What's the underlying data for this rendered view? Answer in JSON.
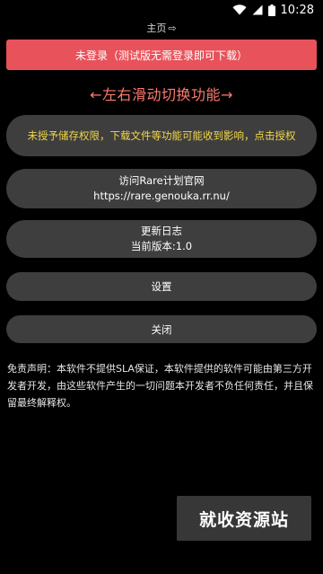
{
  "status_bar": {
    "time": "10:28"
  },
  "top_bar": {
    "title": "主页",
    "arrow": "⇨"
  },
  "login_banner": {
    "text": "未登录（测试版无需登录即可下载）"
  },
  "swipe_hint": {
    "text": "←左右滑动切换功能→"
  },
  "permission_notice": {
    "text": "未授予储存权限，下载文件等功能可能收到影响，点击授权"
  },
  "website": {
    "title": "访问Rare计划官网",
    "url": "https://rare.genouka.rr.nu/"
  },
  "changelog": {
    "title": "更新日志",
    "version": "当前版本:1.0"
  },
  "settings": {
    "label": "设置"
  },
  "close": {
    "label": "关闭"
  },
  "disclaimer": {
    "text": "免责声明：本软件不提供SLA保证，本软件提供的软件可能由第三方开发者开发，由这些软件产生的一切问题本开发者不负任何责任，并且保留最终解释权。"
  },
  "watermark": {
    "text": "就收资源站"
  },
  "colors": {
    "banner": "#e8525a",
    "hint": "#ff7b6e",
    "notice": "#f2d64a",
    "card": "#3e3e3e"
  }
}
